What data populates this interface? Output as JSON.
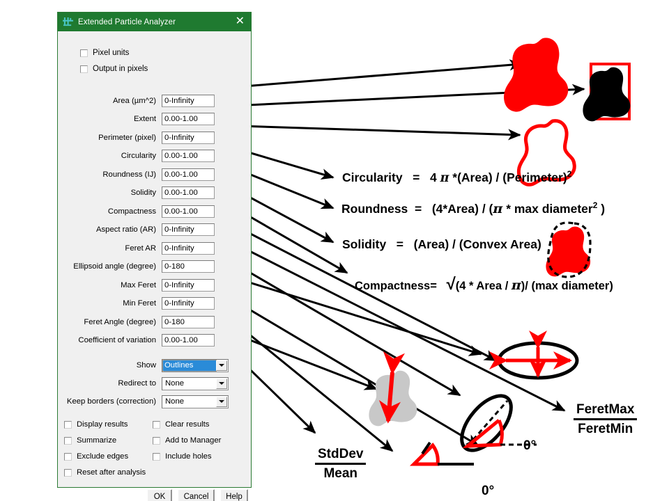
{
  "window": {
    "title": "Extended Particle Analyzer",
    "icon": "particle-analyzer-icon",
    "close_label": "✕",
    "titlebar_color": "#1f7a30"
  },
  "options": {
    "pixel_units": "Pixel units",
    "output_in_pixels": "Output in pixels"
  },
  "fields": [
    {
      "label": "Area (µm^2)",
      "value": "0-Infinity"
    },
    {
      "label": "Extent",
      "value": "0.00-1.00"
    },
    {
      "label": "Perimeter (pixel)",
      "value": "0-Infinity"
    },
    {
      "label": "Circularity",
      "value": "0.00-1.00"
    },
    {
      "label": "Roundness (IJ)",
      "value": "0.00-1.00"
    },
    {
      "label": "Solidity",
      "value": "0.00-1.00"
    },
    {
      "label": "Compactness",
      "value": "0.00-1.00"
    },
    {
      "label": "Aspect ratio (AR)",
      "value": "0-Infinity"
    },
    {
      "label": "Feret AR",
      "value": "0-Infinity"
    },
    {
      "label": "Ellipsoid angle (degree)",
      "value": "0-180"
    },
    {
      "label": "Max Feret",
      "value": "0-Infinity"
    },
    {
      "label": "Min Feret",
      "value": "0-Infinity"
    },
    {
      "label": "Feret Angle (degree)",
      "value": "0-180"
    },
    {
      "label": "Coefficient of variation",
      "value": "0.00-1.00"
    }
  ],
  "combos": [
    {
      "label": "Show",
      "value": "Outlines",
      "selected": true
    },
    {
      "label": "Redirect to",
      "value": "None",
      "selected": false
    },
    {
      "label": "Keep borders (correction)",
      "value": "None",
      "selected": false
    }
  ],
  "checkboxes": [
    {
      "label": "Display results"
    },
    {
      "label": "Clear results"
    },
    {
      "label": "Summarize"
    },
    {
      "label": "Add to Manager"
    },
    {
      "label": "Exclude edges"
    },
    {
      "label": "Include holes"
    },
    {
      "label": "Reset after analysis"
    }
  ],
  "buttons": {
    "ok": "OK",
    "cancel": "Cancel",
    "help": "Help"
  },
  "annotations": {
    "circularity": {
      "name": "Circularity",
      "eq": "=",
      "rhs_a": "4",
      "pi": "π",
      "rhs_b": "*(Area) / (Perimeter)",
      "sup": "2"
    },
    "roundness": {
      "name": "Roundness",
      "eq": "=",
      "rhs_a": "(4*Area) / (",
      "pi": "π",
      "rhs_b": "* max diameter",
      "sup": "2",
      "rhs_c": ")"
    },
    "solidity": {
      "name": "Solidity",
      "eq": "=",
      "rhs": "(Area) / (Convex Area)"
    },
    "compactness": {
      "name": "Compactness=",
      "radical": "√",
      "rhs_a": "(4 * Area / ",
      "pi": "π",
      "rhs_b": ")/ (max diameter)"
    },
    "stddev_mean": {
      "numerator": "StdDev",
      "denominator": "Mean"
    },
    "feret_ratio": {
      "numerator": "FeretMax",
      "denominator": "FeretMin"
    },
    "zero_degree_ellipse": "0°",
    "zero_degree_feret": "0°"
  },
  "colors": {
    "particle_red": "#ff0000",
    "particle_black": "#000000",
    "particle_gray": "#c8c8c8",
    "arrow_black": "#000000",
    "bbox_red": "#ff0000",
    "title_green": "#1f7a30",
    "combo_highlight": "#2a8bd8"
  }
}
